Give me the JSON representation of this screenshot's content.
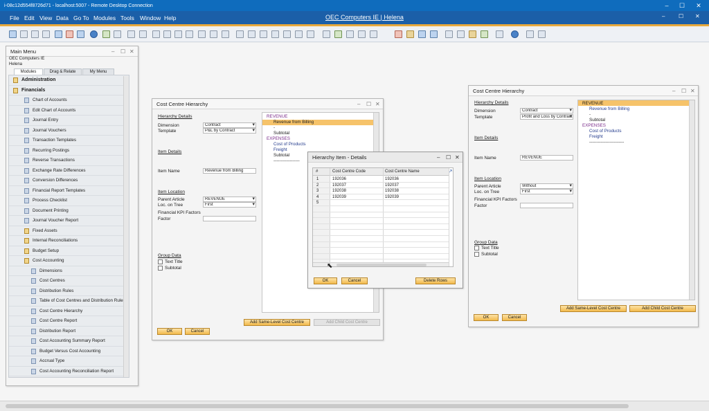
{
  "rdp": {
    "title": "i-08c12d554f8726d71 - localhost:5007 - Remote Desktop Connection",
    "minimize": "–",
    "maximize": "☐",
    "close": "✕"
  },
  "menubar": {
    "items": [
      "File",
      "Edit",
      "View",
      "Data",
      "Go To",
      "Modules",
      "Tools",
      "Window",
      "Help"
    ],
    "center_title": "OEC Computers IE | Helena",
    "wctl": [
      "–",
      "☐",
      "✕"
    ]
  },
  "main_menu": {
    "title": "Main Menu",
    "company": "OEC Computers IE",
    "user": "Helena",
    "tabs": [
      "Modules",
      "Drag & Relate",
      "My Menu"
    ],
    "items": [
      {
        "label": "Administration",
        "level": 0,
        "bold": true
      },
      {
        "label": "Financials",
        "level": 0,
        "bold": true
      },
      {
        "label": "Chart of Accounts",
        "level": 1
      },
      {
        "label": "Edit Chart of Accounts",
        "level": 1
      },
      {
        "label": "Journal Entry",
        "level": 1
      },
      {
        "label": "Journal Vouchers",
        "level": 1
      },
      {
        "label": "Transaction Templates",
        "level": 1
      },
      {
        "label": "Recurring Postings",
        "level": 1
      },
      {
        "label": "Reverse Transactions",
        "level": 1
      },
      {
        "label": "Exchange Rate Differences",
        "level": 1
      },
      {
        "label": "Conversion Differences",
        "level": 1
      },
      {
        "label": "Financial Report Templates",
        "level": 1
      },
      {
        "label": "Process Checklist",
        "level": 1
      },
      {
        "label": "Document Printing",
        "level": 1
      },
      {
        "label": "Journal Voucher Report",
        "level": 1
      },
      {
        "label": "Fixed Assets",
        "level": 1,
        "folder": true
      },
      {
        "label": "Internal Reconciliations",
        "level": 1,
        "folder": true
      },
      {
        "label": "Budget Setup",
        "level": 1,
        "folder": true
      },
      {
        "label": "Cost Accounting",
        "level": 1,
        "folder": true
      },
      {
        "label": "Dimensions",
        "level": 2
      },
      {
        "label": "Cost Centres",
        "level": 2
      },
      {
        "label": "Distribution Rules",
        "level": 2
      },
      {
        "label": "Table of Cost Centres and Distribution Rules",
        "level": 2
      },
      {
        "label": "Cost Centre Hierarchy",
        "level": 2
      },
      {
        "label": "Cost Centre Report",
        "level": 2
      },
      {
        "label": "Distribution Report",
        "level": 2
      },
      {
        "label": "Cost Accounting Summary Report",
        "level": 2
      },
      {
        "label": "Budget Versus Cost Accounting",
        "level": 2
      },
      {
        "label": "Accrual Type",
        "level": 2
      },
      {
        "label": "Cost Accounting Reconciliation Report",
        "level": 2
      }
    ]
  },
  "cch1": {
    "title": "Cost Centre Hierarchy",
    "hierarchy_details": "Hierarchy Details",
    "dimension_label": "Dimension",
    "dimension_value": "Contract",
    "template_label": "Template",
    "template_value": "P&L by Contract",
    "item_details": "Item Details",
    "item_name_label": "Item Name",
    "item_name_value": "Revenue from Billing",
    "item_location": "Item Location",
    "parent_article_label": "Parent Article",
    "parent_article_value": "REVENUE",
    "loc_on_tree_label": "Loc. on Tree",
    "loc_on_tree_value": "First",
    "kpi_label": "Financial KPI Factors",
    "factor_label": "Factor",
    "group_data": "Group Data",
    "text_title": "Text Title",
    "subtotal_cb": "Subtotal",
    "ok": "OK",
    "cancel": "Cancel",
    "add_same": "Add Same-Level Cost Centre",
    "add_child": "Add Child Cost Centre",
    "tree": [
      "REVENUE",
      "Revenue from Billing",
      "-",
      "Subtotal",
      "EXPENSES",
      "Cost of Products",
      "Freight",
      "Subtotal",
      "------------------"
    ]
  },
  "hid": {
    "title": "Hierarchy Item - Details",
    "col_num": "#",
    "col_code": "Cost Centre Code",
    "col_name": "Cost Centre Name",
    "rows": [
      {
        "n": "1",
        "code": "192036",
        "name": "192036"
      },
      {
        "n": "2",
        "code": "192037",
        "name": "192037"
      },
      {
        "n": "3",
        "code": "192038",
        "name": "192038"
      },
      {
        "n": "4",
        "code": "192039",
        "name": "192039"
      },
      {
        "n": "5",
        "code": "",
        "name": ""
      }
    ],
    "ok": "OK",
    "cancel": "Cancel",
    "delete_rows": "Delete Rows"
  },
  "cch2": {
    "title": "Cost Centre Hierarchy",
    "hierarchy_details": "Hierarchy Details",
    "dimension_label": "Dimension",
    "dimension_value": "Contract",
    "template_label": "Template",
    "template_value": "Profit and Loss by Contract",
    "item_details": "Item Details",
    "item_name_label": "Item Name",
    "item_name_value": "REVENUE",
    "item_location": "Item Location",
    "parent_article_label": "Parent Article",
    "parent_article_value": "Without",
    "loc_on_tree_label": "Loc. on Tree",
    "loc_on_tree_value": "First",
    "kpi_label": "Financial KPI Factors",
    "factor_label": "Factor",
    "group_data": "Group Data",
    "text_title": "Text Title",
    "subtotal_cb": "Subtotal",
    "ok": "OK",
    "cancel": "Cancel",
    "add_same": "Add Same-Level Cost Centre",
    "add_child": "Add Child Cost Centre",
    "tree": [
      "REVENUE",
      "Revenue from Billing",
      "-",
      "Subtotal",
      "EXPENSES",
      "Cost of Products",
      "Freight",
      "------------------------"
    ]
  },
  "colors": {
    "accent": "#f2b94a",
    "selection": "#f6c36a",
    "menubar": "#1b5fa8",
    "tree_header": "#7a2b8a"
  }
}
